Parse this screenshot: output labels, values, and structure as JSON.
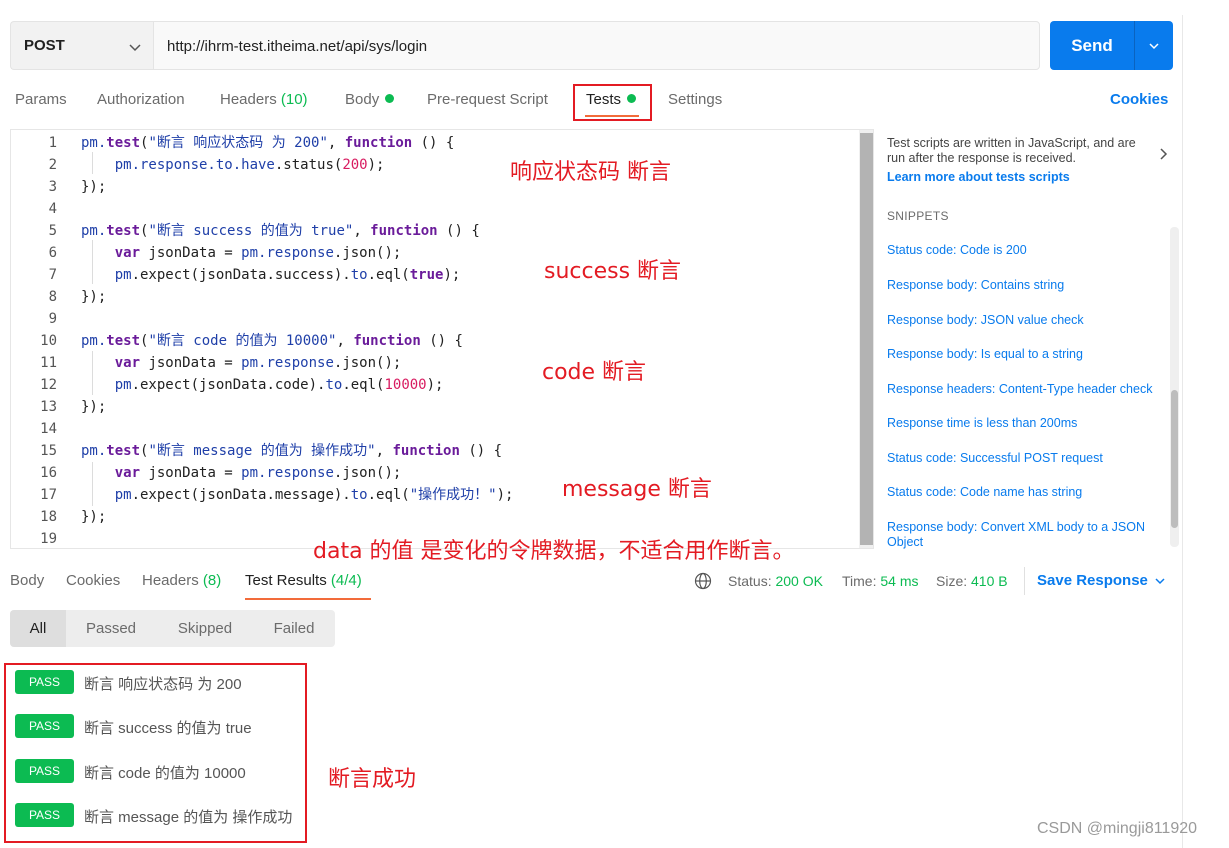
{
  "request": {
    "method": "POST",
    "url": "http://ihrm-test.itheima.net/api/sys/login",
    "send_label": "Send"
  },
  "request_tabs": {
    "params": "Params",
    "authorization": "Authorization",
    "headers": "Headers",
    "headers_count": "(10)",
    "body": "Body",
    "pre_request": "Pre-request Script",
    "tests": "Tests",
    "settings": "Settings",
    "cookies": "Cookies"
  },
  "editor": {
    "line_numbers": [
      "1",
      "2",
      "3",
      "4",
      "5",
      "6",
      "7",
      "8",
      "9",
      "10",
      "11",
      "12",
      "13",
      "14",
      "15",
      "16",
      "17",
      "18",
      "19"
    ],
    "lines": [
      [
        [
          "obj",
          "pm."
        ],
        [
          "kw",
          "test"
        ],
        [
          "",
          "("
        ],
        [
          "str",
          "\"断言 响应状态码 为 200\""
        ],
        [
          "",
          ", "
        ],
        [
          "kw",
          "function"
        ],
        [
          "",
          " () {"
        ]
      ],
      [
        [
          "",
          "    "
        ],
        [
          "obj",
          "pm.response.to.have"
        ],
        [
          "",
          ".status("
        ],
        [
          "num",
          "200"
        ],
        [
          "",
          ");"
        ]
      ],
      [
        [
          "",
          "});"
        ]
      ],
      [
        [
          "",
          ""
        ]
      ],
      [
        [
          "obj",
          "pm."
        ],
        [
          "kw",
          "test"
        ],
        [
          "",
          "("
        ],
        [
          "str",
          "\"断言 success 的值为 true\""
        ],
        [
          "",
          ", "
        ],
        [
          "kw",
          "function"
        ],
        [
          "",
          " () {"
        ]
      ],
      [
        [
          "",
          "    "
        ],
        [
          "kw",
          "var"
        ],
        [
          "",
          " jsonData = "
        ],
        [
          "obj",
          "pm.response"
        ],
        [
          "",
          ".json();"
        ]
      ],
      [
        [
          "",
          "    "
        ],
        [
          "obj",
          "pm"
        ],
        [
          "",
          ".expect(jsonData.success)."
        ],
        [
          "obj",
          "to"
        ],
        [
          "",
          ".eql("
        ],
        [
          "kw",
          "true"
        ],
        [
          "",
          ");"
        ]
      ],
      [
        [
          "",
          "});"
        ]
      ],
      [
        [
          "",
          ""
        ]
      ],
      [
        [
          "obj",
          "pm."
        ],
        [
          "kw",
          "test"
        ],
        [
          "",
          "("
        ],
        [
          "str",
          "\"断言 code 的值为 10000\""
        ],
        [
          "",
          ", "
        ],
        [
          "kw",
          "function"
        ],
        [
          "",
          " () {"
        ]
      ],
      [
        [
          "",
          "    "
        ],
        [
          "kw",
          "var"
        ],
        [
          "",
          " jsonData = "
        ],
        [
          "obj",
          "pm.response"
        ],
        [
          "",
          ".json();"
        ]
      ],
      [
        [
          "",
          "    "
        ],
        [
          "obj",
          "pm"
        ],
        [
          "",
          ".expect(jsonData.code)."
        ],
        [
          "obj",
          "to"
        ],
        [
          "",
          ".eql("
        ],
        [
          "num",
          "10000"
        ],
        [
          "",
          ");"
        ]
      ],
      [
        [
          "",
          "});"
        ]
      ],
      [
        [
          "",
          ""
        ]
      ],
      [
        [
          "obj",
          "pm."
        ],
        [
          "kw",
          "test"
        ],
        [
          "",
          "("
        ],
        [
          "str",
          "\"断言 message 的值为 操作成功\""
        ],
        [
          "",
          ", "
        ],
        [
          "kw",
          "function"
        ],
        [
          "",
          " () {"
        ]
      ],
      [
        [
          "",
          "    "
        ],
        [
          "kw",
          "var"
        ],
        [
          "",
          " jsonData = "
        ],
        [
          "obj",
          "pm.response"
        ],
        [
          "",
          ".json();"
        ]
      ],
      [
        [
          "",
          "    "
        ],
        [
          "obj",
          "pm"
        ],
        [
          "",
          ".expect(jsonData.message)."
        ],
        [
          "obj",
          "to"
        ],
        [
          "",
          ".eql("
        ],
        [
          "str",
          "\"操作成功！\""
        ],
        [
          "",
          ");"
        ]
      ],
      [
        [
          "",
          "});"
        ]
      ],
      [
        [
          "",
          ""
        ]
      ]
    ]
  },
  "annotations": {
    "a1": "响应状态码 断言",
    "a2": "success 断言",
    "a3": "code 断言",
    "a4": "message 断言",
    "a5": "data 的值 是变化的令牌数据，不适合用作断言。",
    "a6": "断言成功"
  },
  "snippets": {
    "description": "Test scripts are written in JavaScript, and are run after the response is received.",
    "learn_more": "Learn more about tests scripts",
    "heading": "SNIPPETS",
    "items": [
      "Status code: Code is 200",
      "Response body: Contains string",
      "Response body: JSON value check",
      "Response body: Is equal to a string",
      "Response headers: Content-Type header check",
      "Response time is less than 200ms",
      "Status code: Successful POST request",
      "Status code: Code name has string",
      "Response body: Convert XML body to a JSON Object"
    ]
  },
  "response_tabs": {
    "body": "Body",
    "cookies": "Cookies",
    "headers": "Headers",
    "headers_count": "(8)",
    "test_results": "Test Results",
    "test_results_count": "(4/4)"
  },
  "status": {
    "status_label": "Status:",
    "status_value": "200 OK",
    "time_label": "Time:",
    "time_value": "54 ms",
    "size_label": "Size:",
    "size_value": "410 B",
    "save_response": "Save Response"
  },
  "filters": [
    "All",
    "Passed",
    "Skipped",
    "Failed"
  ],
  "results": [
    {
      "badge": "PASS",
      "name": "断言 响应状态码 为 200"
    },
    {
      "badge": "PASS",
      "name": "断言 success 的值为 true"
    },
    {
      "badge": "PASS",
      "name": "断言 code 的值为 10000"
    },
    {
      "badge": "PASS",
      "name": "断言 message 的值为 操作成功"
    }
  ],
  "watermark": "CSDN @mingji811920",
  "colors": {
    "accent": "#097bed",
    "pass": "#0cbb52",
    "tab_underline": "#f26b3a",
    "annotation": "#e31b23"
  }
}
